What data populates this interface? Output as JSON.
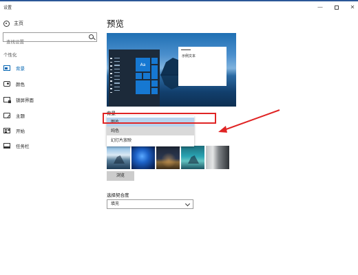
{
  "window": {
    "title": "设置",
    "minimize": "—",
    "close": "✕"
  },
  "sidebar": {
    "home_label": "主页",
    "search_placeholder": "查找设置",
    "section_title": "个性化",
    "items": [
      {
        "label": "背景",
        "icon": "background-icon",
        "active": true
      },
      {
        "label": "颜色",
        "icon": "color-icon",
        "active": false
      },
      {
        "label": "锁屏界面",
        "icon": "lock-screen-icon",
        "active": false
      },
      {
        "label": "主题",
        "icon": "theme-icon",
        "active": false
      },
      {
        "label": "开始",
        "icon": "start-icon",
        "active": false
      },
      {
        "label": "任务栏",
        "icon": "taskbar-icon",
        "active": false
      }
    ]
  },
  "main": {
    "title": "预览",
    "preview": {
      "tile_label": "Aa",
      "sample_text": "示例文本"
    },
    "background_label": "背景",
    "background_options": [
      {
        "label": "图片",
        "state": "selected"
      },
      {
        "label": "纯色",
        "state": "highlighted"
      },
      {
        "label": "幻灯片放映",
        "state": "normal"
      }
    ],
    "browse_button": "浏览",
    "fit_label": "选择契合度",
    "fit_value": "填充"
  },
  "colors": {
    "accent": "#0063b1",
    "annotation": "#e02424"
  }
}
